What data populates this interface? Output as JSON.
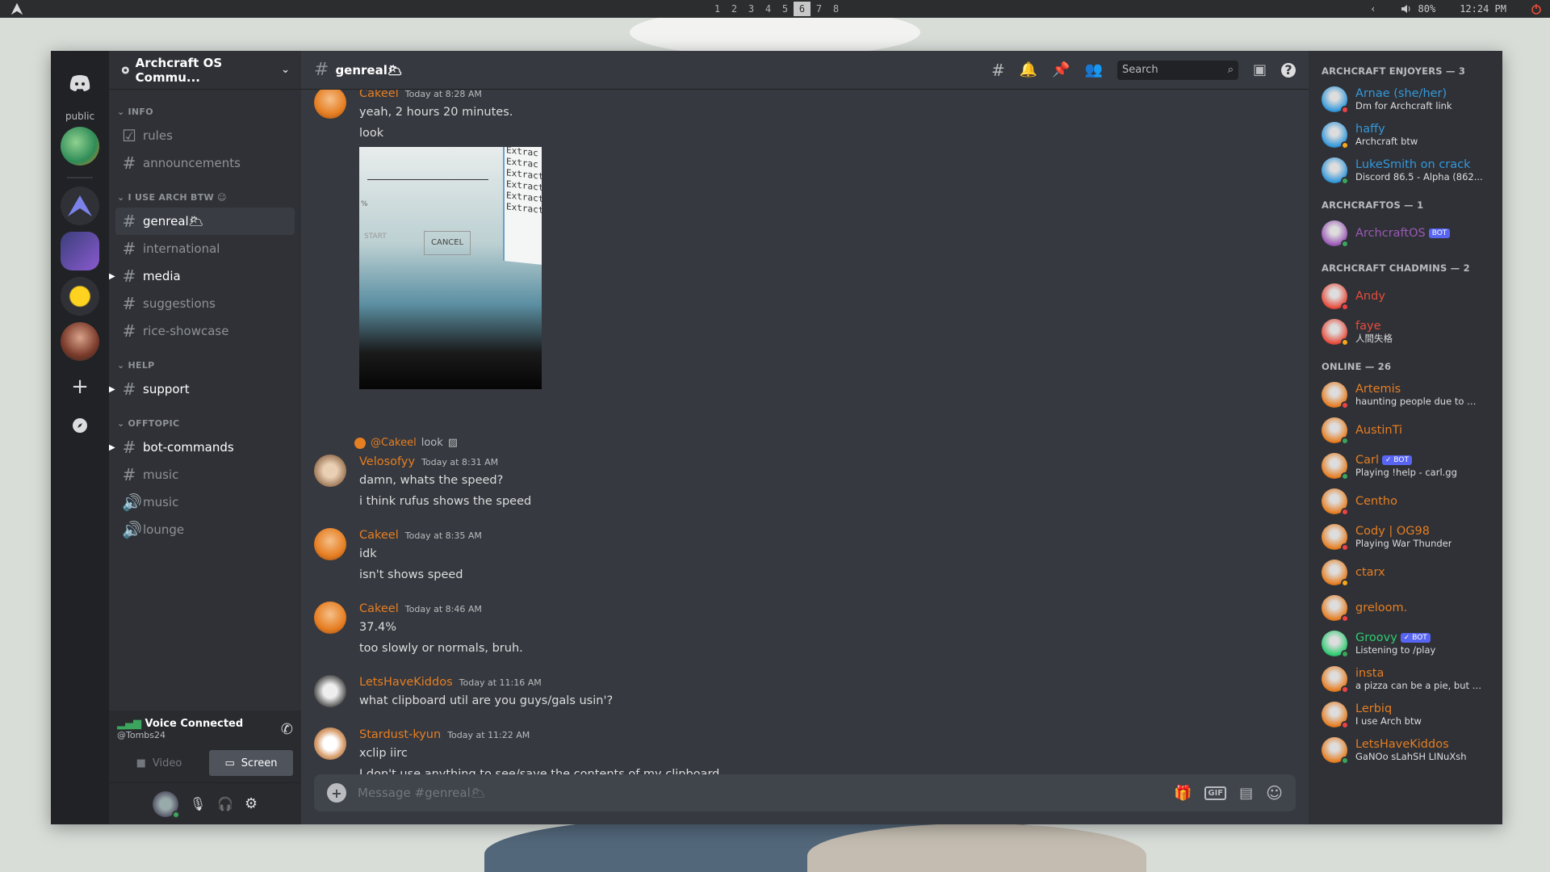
{
  "topbar": {
    "workspaces": [
      "1",
      "2",
      "3",
      "4",
      "5",
      "6",
      "7",
      "8"
    ],
    "active_workspace": "6",
    "volume": "80%",
    "time": "12:24 PM"
  },
  "servers": {
    "label": "public"
  },
  "guild": {
    "name": "Archcraft OS Commu...",
    "categories": [
      {
        "name": "INFO",
        "channels": [
          {
            "name": "rules",
            "icon": "rules-icon"
          },
          {
            "name": "announcements",
            "icon": "hash-icon"
          }
        ]
      },
      {
        "name": "I USE ARCH BTW",
        "channels": [
          {
            "name": "genreal🌥",
            "icon": "hash-icon"
          },
          {
            "name": "international",
            "icon": "hash-icon"
          },
          {
            "name": "media",
            "icon": "hash-icon"
          },
          {
            "name": "suggestions",
            "icon": "hash-icon"
          },
          {
            "name": "rice-showcase",
            "icon": "hash-icon"
          }
        ]
      },
      {
        "name": "HELP",
        "channels": [
          {
            "name": "support",
            "icon": "hash-icon"
          }
        ]
      },
      {
        "name": "OFFTOPIC",
        "channels": [
          {
            "name": "bot-commands",
            "icon": "hash-icon"
          },
          {
            "name": "music",
            "icon": "hash-icon"
          },
          {
            "name": "music",
            "icon": "speaker-icon"
          },
          {
            "name": "lounge",
            "icon": "speaker-icon"
          }
        ]
      }
    ]
  },
  "voice": {
    "title": "Voice Connected",
    "sub": "@Tombs24",
    "video_label": "Video",
    "screen_label": "Screen"
  },
  "chat": {
    "channel": "genreal🌥",
    "search_placeholder": "Search",
    "input_placeholder": "Message #genreal🌥",
    "messages": [
      {
        "author": "Cakeel",
        "ts": "Today at 8:28 AM",
        "lines": [
          "yeah, 2 hours 20 minutes.",
          "look"
        ]
      },
      {
        "author": "Velosofyy",
        "ts": "Today at 8:31 AM",
        "reply": "@Cakeel",
        "reply_text": "look",
        "lines": [
          "damn, whats the speed?",
          "i think rufus shows the speed"
        ]
      },
      {
        "author": "Cakeel",
        "ts": "Today at 8:35 AM",
        "lines": [
          "idk",
          "isn't shows speed"
        ]
      },
      {
        "author": "Cakeel",
        "ts": "Today at 8:46 AM",
        "lines": [
          "37.4%",
          "too slowly or normals, bruh."
        ]
      },
      {
        "author": "LetsHaveKiddos",
        "ts": "Today at 11:16 AM",
        "lines": [
          "what clipboard util are you guys/gals usin'?"
        ]
      },
      {
        "author": "Stardust-kyun",
        "ts": "Today at 11:22 AM",
        "lines": [
          "xclip iirc",
          "I don't use anything to see/save the contents of my clipboard"
        ]
      }
    ],
    "image_texts": [
      "Extrac",
      "Extrac",
      "Extract",
      "Extracti",
      "Extractin",
      "Extractin",
      "START",
      "CANCEL",
      "%"
    ]
  },
  "members": {
    "groups": [
      {
        "title": "ARCHCRAFT ENJOYERS — 3",
        "items": [
          {
            "name": "Arnae (she/her)",
            "status": "Dm for Archcraft link",
            "color": "#3498db",
            "dot": "#ed4245"
          },
          {
            "name": "haffy",
            "status": "Archcraft btw",
            "color": "#3498db",
            "dot": "#faa61a"
          },
          {
            "name": "LukeSmith on crack",
            "status": "Discord 86.5 - Alpha (862...",
            "color": "#3498db",
            "dot": "#3ba55d"
          }
        ]
      },
      {
        "title": "ARCHCRAFTOS — 1",
        "items": [
          {
            "name": "ArchcraftOS",
            "status": "",
            "color": "#9b59b6",
            "dot": "#3ba55d",
            "bot": "BOT"
          }
        ]
      },
      {
        "title": "ARCHCRAFT CHADMINS — 2",
        "items": [
          {
            "name": "Andy",
            "status": "",
            "color": "#e74c3c",
            "dot": "#ed4245"
          },
          {
            "name": "faye",
            "status": "人間失格",
            "color": "#e74c3c",
            "dot": "#faa61a"
          }
        ]
      },
      {
        "title": "ONLINE — 26",
        "items": [
          {
            "name": "Artemis",
            "status": "haunting people due to my ...",
            "color": "#e67e22",
            "dot": "#ed4245"
          },
          {
            "name": "AustinTi",
            "status": "",
            "color": "#e67e22",
            "dot": "#3ba55d"
          },
          {
            "name": "Carl",
            "status": "Playing !help - carl.gg",
            "color": "#e67e22",
            "dot": "#3ba55d",
            "bot": "✓ BOT"
          },
          {
            "name": "Centho",
            "status": "",
            "color": "#e67e22",
            "dot": "#ed4245"
          },
          {
            "name": "Cody | OG98",
            "status": "Playing War Thunder",
            "color": "#e67e22",
            "dot": "#ed4245"
          },
          {
            "name": "ctarx",
            "status": "",
            "color": "#e67e22",
            "dot": "#faa61a"
          },
          {
            "name": "greloom.",
            "status": "",
            "color": "#e67e22",
            "dot": "#ed4245"
          },
          {
            "name": "Groovy",
            "status": "Listening to /play",
            "color": "#2ecc71",
            "dot": "#3ba55d",
            "bot": "✓ BOT"
          },
          {
            "name": "insta",
            "status": "a pizza can be a pie, but a pie i...",
            "color": "#e67e22",
            "dot": "#ed4245"
          },
          {
            "name": "Lerbiq",
            "status": "I use Arch btw",
            "color": "#e67e22",
            "dot": "#ed4245"
          },
          {
            "name": "LetsHaveKiddos",
            "status": "GaNOo sLahSH LINuXsh",
            "color": "#e67e22",
            "dot": "#3ba55d"
          }
        ]
      }
    ]
  },
  "colors": {
    "accent": "#5865f2",
    "author": "#e67e22",
    "bg_main": "#36393f",
    "bg_side": "#2f3136",
    "bg_rail": "#202225"
  }
}
